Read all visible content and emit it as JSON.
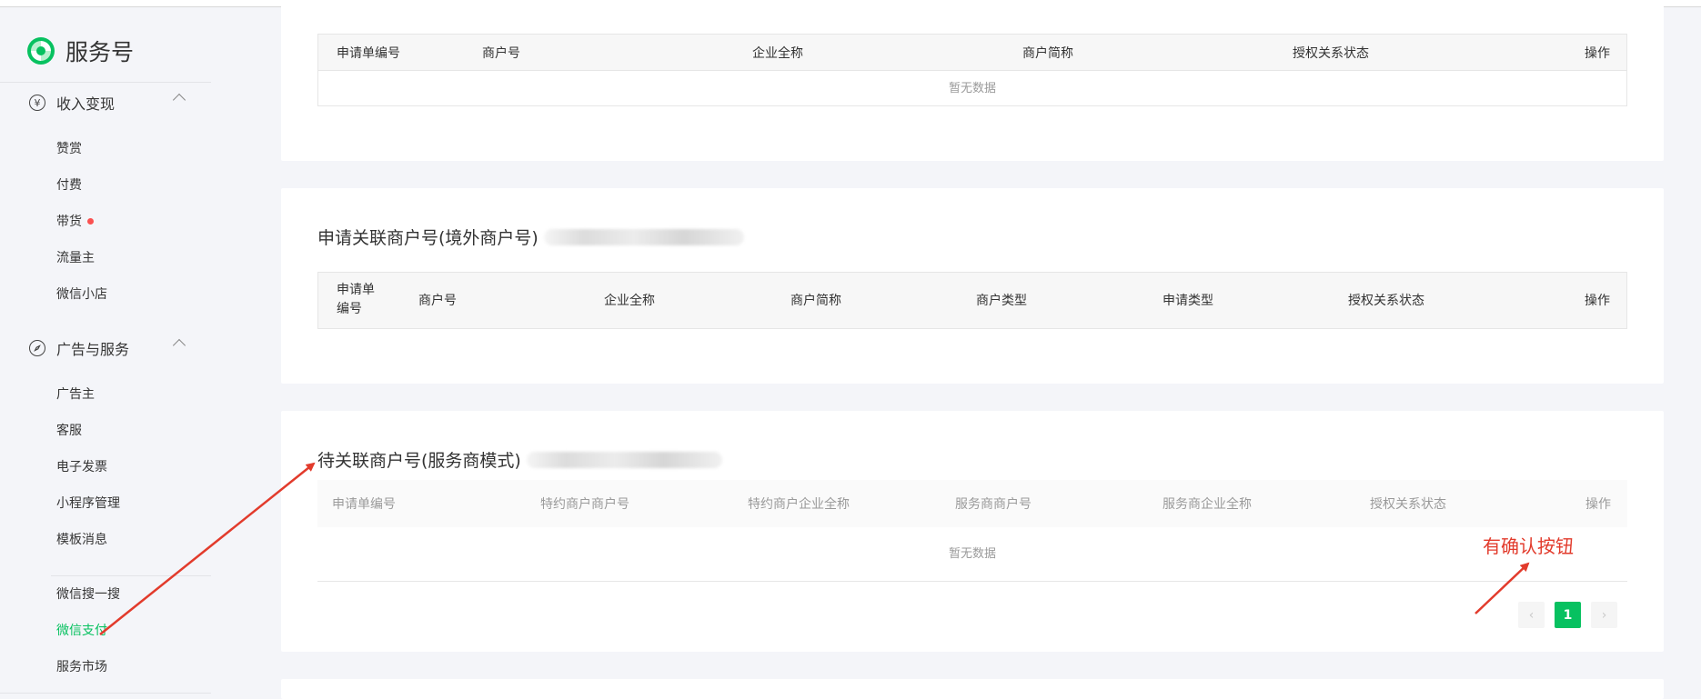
{
  "app": {
    "title": "服务号"
  },
  "sidebar": {
    "groups": [
      {
        "label": "收入变现",
        "icon": "yen-icon",
        "items": [
          "赞赏",
          "付费",
          "带货",
          "流量主",
          "微信小店"
        ]
      },
      {
        "label": "广告与服务",
        "icon": "compass-icon",
        "items": [
          "广告主",
          "客服",
          "电子发票",
          "小程序管理",
          "模板消息",
          "微信搜一搜",
          "微信支付",
          "服务市场"
        ]
      }
    ],
    "icons": {
      "yen": "¥"
    },
    "active_item": "微信支付",
    "dot_item": "带货"
  },
  "panel1": {
    "columns": [
      "申请单编号",
      "商户号",
      "企业全称",
      "商户简称",
      "授权关系状态",
      "操作"
    ],
    "empty": "暂无数据"
  },
  "panel2": {
    "title": "申请关联商户号(境外商户号)",
    "columns": [
      "申请单编号",
      "商户号",
      "企业全称",
      "商户简称",
      "商户类型",
      "申请类型",
      "授权关系状态",
      "操作"
    ],
    "col0_line1": "申请单",
    "col0_line2": "编号"
  },
  "panel3": {
    "title": "待关联商户号(服务商模式)",
    "columns": [
      "申请单编号",
      "特约商户商户号",
      "特约商户企业全称",
      "服务商商户号",
      "服务商企业全称",
      "授权关系状态",
      "操作"
    ],
    "empty": "暂无数据",
    "pagination": {
      "prev": "‹",
      "current": "1",
      "next": "›"
    }
  },
  "annotation": {
    "text": "有确认按钮",
    "color": "#e23b2c"
  },
  "colors": {
    "accent": "#07c160",
    "alert": "#fa5151"
  }
}
